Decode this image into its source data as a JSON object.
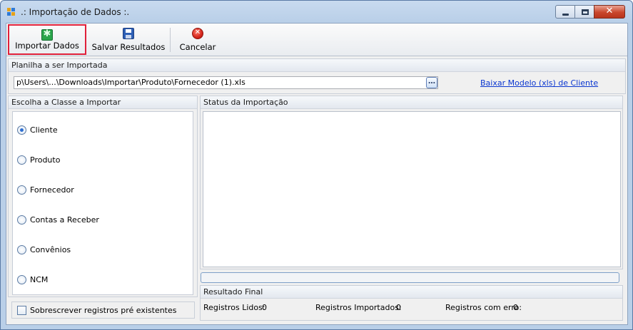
{
  "window": {
    "title": ".: Importação de Dados :."
  },
  "toolbar": {
    "import_label": "Importar Dados",
    "save_label": "Salvar Resultados",
    "cancel_label": "Cancelar"
  },
  "file_group": {
    "header": "Planilha a ser Importada",
    "path_value": "p\\Users\\...\\Downloads\\Importar\\Produto\\Fornecedor (1).xls",
    "browse_label": "…",
    "download_link": "Baixar Modelo (xls) de Cliente"
  },
  "class_group": {
    "header": "Escolha a Classe a Importar",
    "options": [
      {
        "label": "Cliente",
        "checked": true
      },
      {
        "label": "Produto",
        "checked": false
      },
      {
        "label": "Fornecedor",
        "checked": false
      },
      {
        "label": "Contas a Receber",
        "checked": false
      },
      {
        "label": "Convênios",
        "checked": false
      },
      {
        "label": "NCM",
        "checked": false
      }
    ]
  },
  "overwrite_checkbox": {
    "label": "Sobrescrever registros pré existentes",
    "checked": false
  },
  "status_group": {
    "header": "Status da Importação",
    "progress_fraction": 0
  },
  "result_group": {
    "header": "Resultado Final",
    "read_label": "Registros Lidos:",
    "read_value": "0",
    "imported_label": "Registros Importados:",
    "imported_value": "0",
    "error_label": "Registros com erro:",
    "error_value": "0"
  },
  "colors": {
    "accent": "#0a36d0",
    "selection_border": "#e0203a"
  }
}
